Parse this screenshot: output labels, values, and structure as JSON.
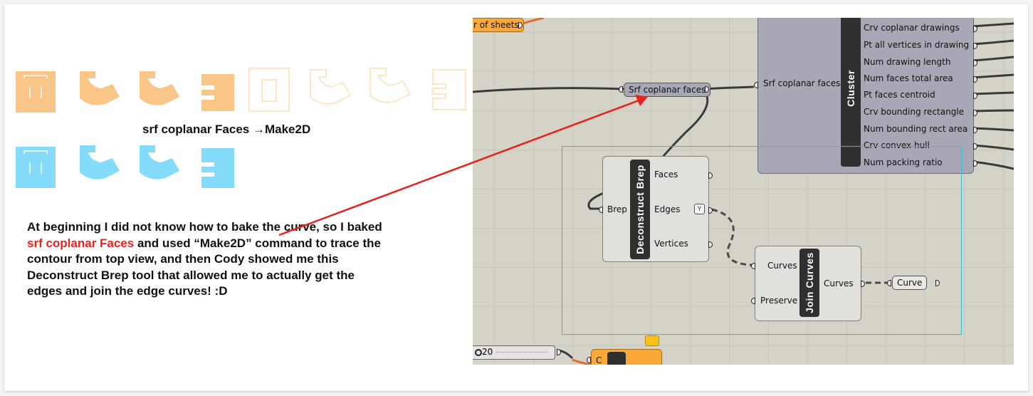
{
  "colors": {
    "orange": "#f9c688",
    "orange_light": "#fde6c6",
    "cyan": "#84dcfa",
    "highlight_red": "#e8231d",
    "selection_cyan": "#2bc0d8"
  },
  "caption": "srf coplanar Faces →Make2D",
  "body": {
    "part1": "At beginning I did not know how to bake the curve, so I baked ",
    "highlight": "srf coplanar Faces",
    "part2": " and used “Make2D” command to trace the contour from top view, and then Cody showed me this Deconstruct Brep tool that allowed me to actually get the edges and join the edge curves! :D"
  },
  "gh": {
    "sheets_label": "r of sheets",
    "srf_param_label": "Srf coplanar faces",
    "cluster": {
      "title": "Cluster",
      "input": "Srf coplanar faces",
      "outputs": [
        "Crv coplanar drawings",
        "Pt all vertices in drawing",
        "Num drawing length",
        "Num faces total area",
        "Pt faces centroid",
        "Crv bounding rectangle",
        "Num bounding rect area",
        "Crv convex hull",
        "Num packing ratio"
      ]
    },
    "deconstruct": {
      "title": "Deconstruct Brep",
      "input": "Brep",
      "outputs": [
        "Faces",
        "Edges",
        "Vertices"
      ]
    },
    "join": {
      "title": "Join Curves",
      "inputs": [
        "Curves",
        "Preserve"
      ],
      "output": "Curves"
    },
    "curve_param": "Curve",
    "slider_value": "20",
    "bottom_comp_label": "C"
  },
  "icons": [
    "flatten-icon",
    "arrow-annotation-icon"
  ]
}
